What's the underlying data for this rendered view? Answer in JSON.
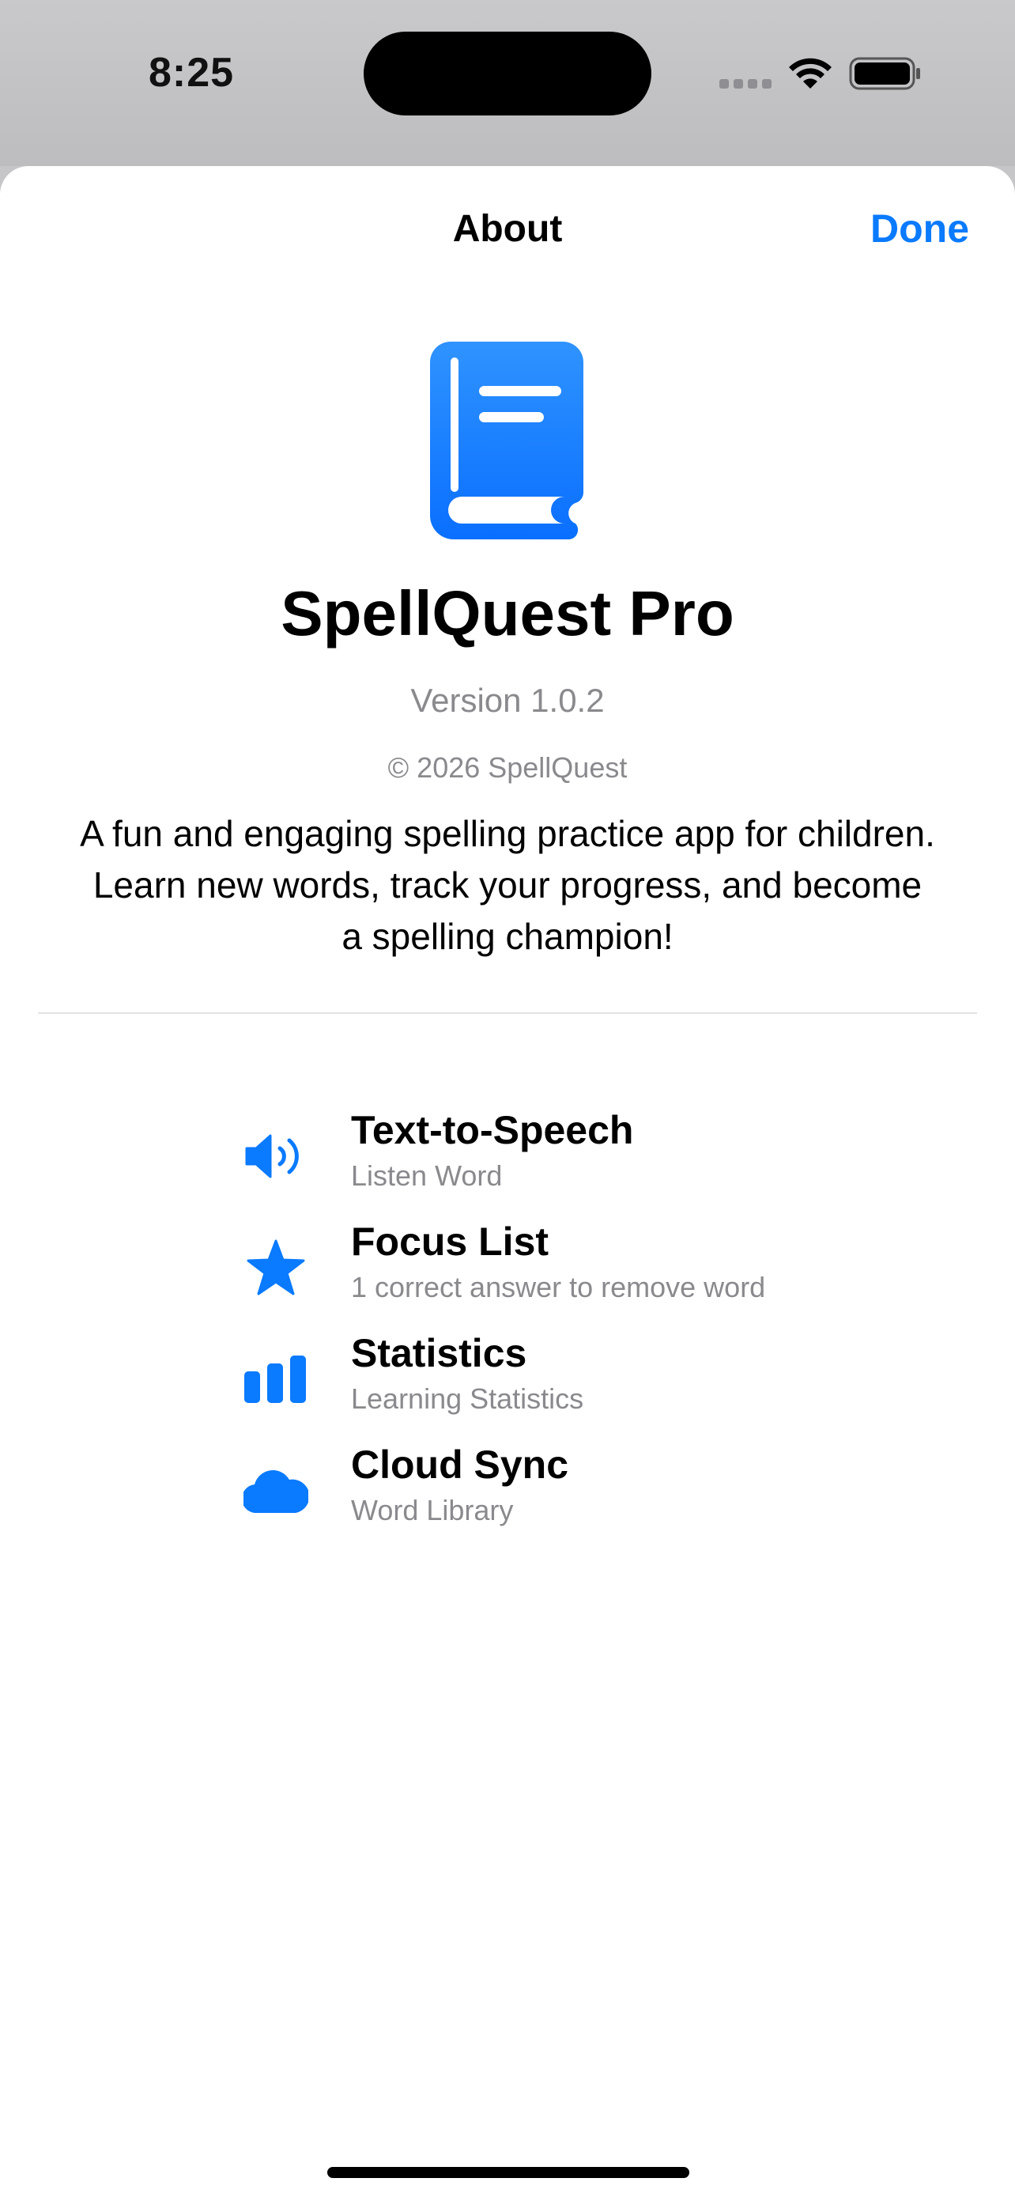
{
  "status_bar": {
    "time": "8:25"
  },
  "nav": {
    "title": "About",
    "done_label": "Done"
  },
  "app": {
    "name": "SpellQuest Pro",
    "version": "Version 1.0.2",
    "copyright": "© 2026 SpellQuest",
    "description": "A fun and engaging spelling practice app for children. Learn new words, track your progress, and become a spelling champion!",
    "icon": "book-icon"
  },
  "features": [
    {
      "icon": "speaker-icon",
      "title": "Text-to-Speech",
      "subtitle": "Listen Word"
    },
    {
      "icon": "star-icon",
      "title": "Focus List",
      "subtitle": "1 correct answer to remove word"
    },
    {
      "icon": "bar-chart-icon",
      "title": "Statistics",
      "subtitle": "Learning Statistics"
    },
    {
      "icon": "cloud-icon",
      "title": "Cloud Sync",
      "subtitle": "Word Library"
    }
  ],
  "colors": {
    "accent": "#0a7aff",
    "secondary_text": "#8a8a8e",
    "divider": "#e3e3e6"
  }
}
